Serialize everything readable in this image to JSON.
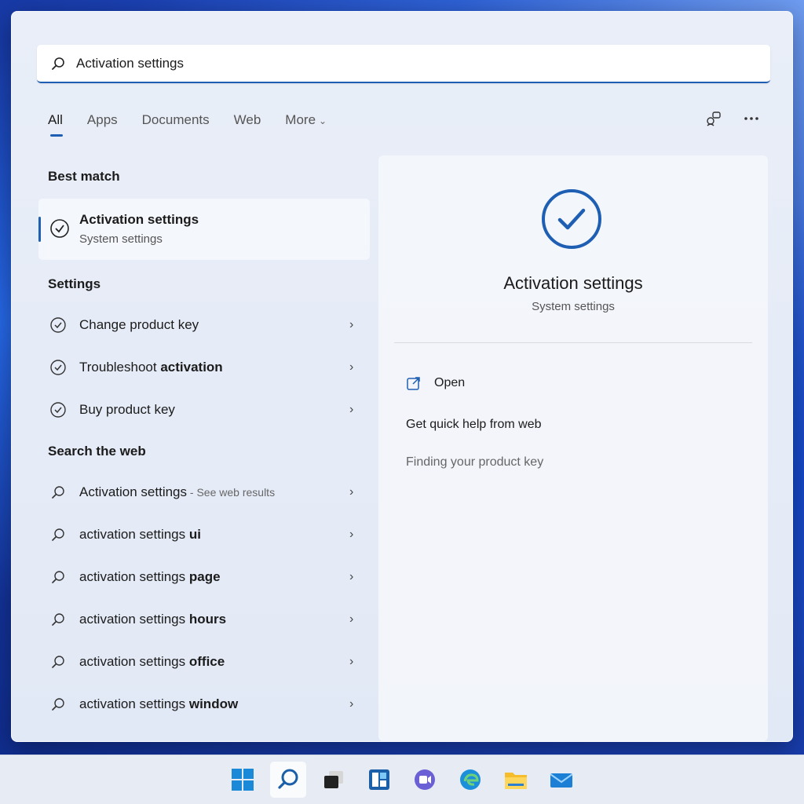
{
  "search": {
    "value": "Activation settings"
  },
  "tabs": [
    {
      "label": "All",
      "active": true
    },
    {
      "label": "Apps"
    },
    {
      "label": "Documents"
    },
    {
      "label": "Web"
    },
    {
      "label": "More"
    }
  ],
  "sections": {
    "best_match": "Best match",
    "settings": "Settings",
    "search_web": "Search the web"
  },
  "best_match": {
    "title": "Activation settings",
    "subtitle": "System settings"
  },
  "settings_items": [
    {
      "label": "Change product key"
    },
    {
      "label_plain": "Troubleshoot ",
      "label_bold": "activation"
    },
    {
      "label": "Buy product key"
    }
  ],
  "web_items": [
    {
      "query": "Activation settings",
      "suffix": " - See web results"
    },
    {
      "query_plain": "activation settings ",
      "query_bold": "ui"
    },
    {
      "query_plain": "activation settings ",
      "query_bold": "page"
    },
    {
      "query_plain": "activation settings ",
      "query_bold": "hours"
    },
    {
      "query_plain": "activation settings ",
      "query_bold": "office"
    },
    {
      "query_plain": "activation settings ",
      "query_bold": "window"
    }
  ],
  "preview": {
    "title": "Activation settings",
    "subtitle": "System settings",
    "open_label": "Open",
    "help_label": "Get quick help from web",
    "link_label": "Finding your product key"
  },
  "colors": {
    "accent": "#1f5fb3",
    "panel": "#e8edf7"
  },
  "taskbar_icons": [
    "start-icon",
    "search-icon",
    "task-view-icon",
    "widgets-icon",
    "chat-icon",
    "edge-icon",
    "file-explorer-icon",
    "mail-icon"
  ]
}
